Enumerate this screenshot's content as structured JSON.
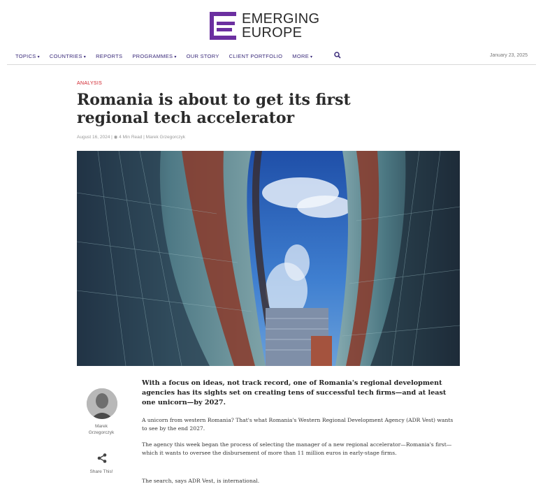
{
  "brand": {
    "line1": "EMERGING",
    "line2": "EUROPE",
    "logo_icon": "emerging-europe-logo-mark",
    "accent_color": "#6b2fa0"
  },
  "nav": {
    "items": [
      {
        "label": "TOPICS",
        "has_dropdown": true
      },
      {
        "label": "COUNTRIES",
        "has_dropdown": true
      },
      {
        "label": "REPORTS",
        "has_dropdown": false
      },
      {
        "label": "PROGRAMMES",
        "has_dropdown": true
      },
      {
        "label": "OUR STORY",
        "has_dropdown": false
      },
      {
        "label": "CLIENT PORTFOLIO",
        "has_dropdown": false
      },
      {
        "label": "MORE",
        "has_dropdown": true
      }
    ],
    "dropdown_glyph": "▾",
    "search_icon": "search-icon",
    "date": "January 23, 2025"
  },
  "article": {
    "category": "ANALYSIS",
    "category_color": "#d0212a",
    "title": "Romania is about to get its first regional tech accelerator",
    "meta": "August 16, 2024 | ◉ 4 Min Read | Marek Grzegorczyk",
    "hero_alt": "fisheye view of curved glass office buildings against blue sky",
    "author": {
      "name_line1": "Marek",
      "name_line2": "Grzegorczyk"
    },
    "share_label": "Share This!",
    "lede": "With a focus on ideas, not track record, one of Romania's regional development agencies has its sights set on creating tens of successful tech firms—and at least one unicorn—by 2027.",
    "paragraphs": [
      "A unicorn from western Romania? That's what Romania's Western Regional Development Agency (ADR Vest) wants to see by the end 2027.",
      "The agency this week began the process of selecting the manager of a new regional accelerator—Romania's first—which it wants to oversee the disbursement of more than 11 million euros in early-stage firms.",
      "The search, says ADR Vest, is international."
    ]
  }
}
